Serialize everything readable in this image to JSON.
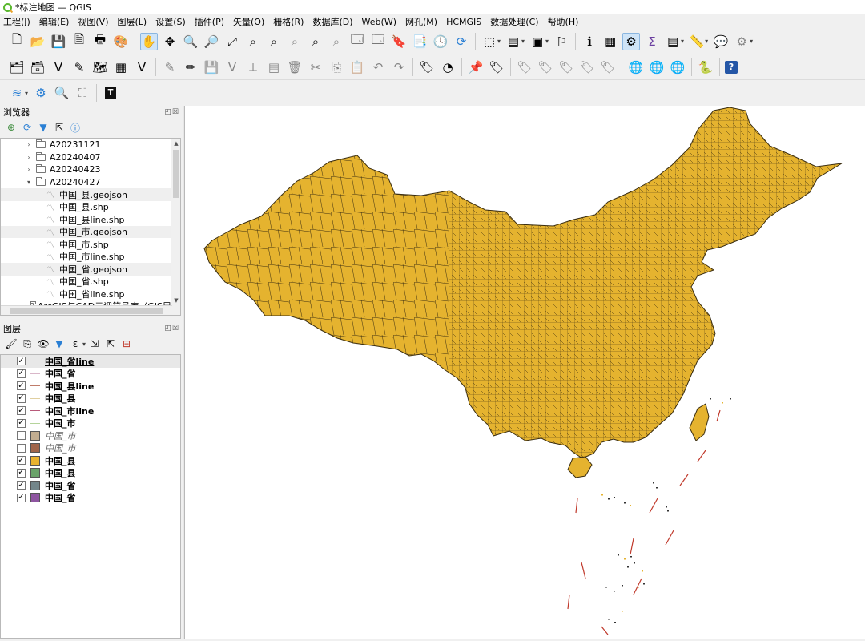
{
  "window": {
    "title": "*标注地图 — QGIS"
  },
  "menu": [
    "工程(J)",
    "编辑(E)",
    "视图(V)",
    "图层(L)",
    "设置(S)",
    "插件(P)",
    "矢量(O)",
    "栅格(R)",
    "数据库(D)",
    "Web(W)",
    "网孔(M)",
    "HCMGIS",
    "数据处理(C)",
    "帮助(H)"
  ],
  "browser": {
    "title": "浏览器",
    "items": [
      {
        "label": "A20231121",
        "kind": "folder",
        "expanded": false
      },
      {
        "label": "A20240407",
        "kind": "folder",
        "expanded": false
      },
      {
        "label": "A20240423",
        "kind": "folder",
        "expanded": false
      },
      {
        "label": "A20240427",
        "kind": "folder",
        "expanded": true
      },
      {
        "label": "中国_县.geojson",
        "kind": "layer"
      },
      {
        "label": "中国_县.shp",
        "kind": "layer"
      },
      {
        "label": "中国_县line.shp",
        "kind": "layer"
      },
      {
        "label": "中国_市.geojson",
        "kind": "layer"
      },
      {
        "label": "中国_市.shp",
        "kind": "layer"
      },
      {
        "label": "中国_市line.shp",
        "kind": "layer"
      },
      {
        "label": "中国_省.geojson",
        "kind": "layer"
      },
      {
        "label": "中国_省.shp",
        "kind": "layer"
      },
      {
        "label": "中国_省line.shp",
        "kind": "layer"
      },
      {
        "label": "ArcGIS与CAD元课符号库（GIS思维",
        "kind": "folder",
        "expanded": false
      }
    ]
  },
  "layers": {
    "title": "图层",
    "items": [
      {
        "label": "中国_省line",
        "checked": true,
        "symbol": "line",
        "color": "#c9a88b",
        "selected": true
      },
      {
        "label": "中国_省",
        "checked": true,
        "symbol": "line",
        "color": "#d9b7c9"
      },
      {
        "label": "中国_县line",
        "checked": true,
        "symbol": "line",
        "color": "#c07c6a"
      },
      {
        "label": "中国_县",
        "checked": true,
        "symbol": "line",
        "color": "#e0cfa0"
      },
      {
        "label": "中国_市line",
        "checked": true,
        "symbol": "line",
        "color": "#b85a7a"
      },
      {
        "label": "中国_市",
        "checked": true,
        "symbol": "line",
        "color": "#b5d49b"
      },
      {
        "label": "中国_市",
        "checked": false,
        "symbol": "fill",
        "color": "#c2ad90"
      },
      {
        "label": "中国_市",
        "checked": false,
        "symbol": "fill",
        "color": "#a0654a"
      },
      {
        "label": "中国_县",
        "checked": true,
        "symbol": "fill",
        "color": "#e8b230"
      },
      {
        "label": "中国_县",
        "checked": true,
        "symbol": "fill",
        "color": "#6aa36a"
      },
      {
        "label": "中国_省",
        "checked": true,
        "symbol": "fill",
        "color": "#73868a"
      },
      {
        "label": "中国_省",
        "checked": true,
        "symbol": "fill",
        "color": "#8e55a0"
      }
    ]
  },
  "map": {
    "fill_color": "#e5b32f",
    "stroke_color": "#3a2d10",
    "island_color": "#c0392b"
  }
}
